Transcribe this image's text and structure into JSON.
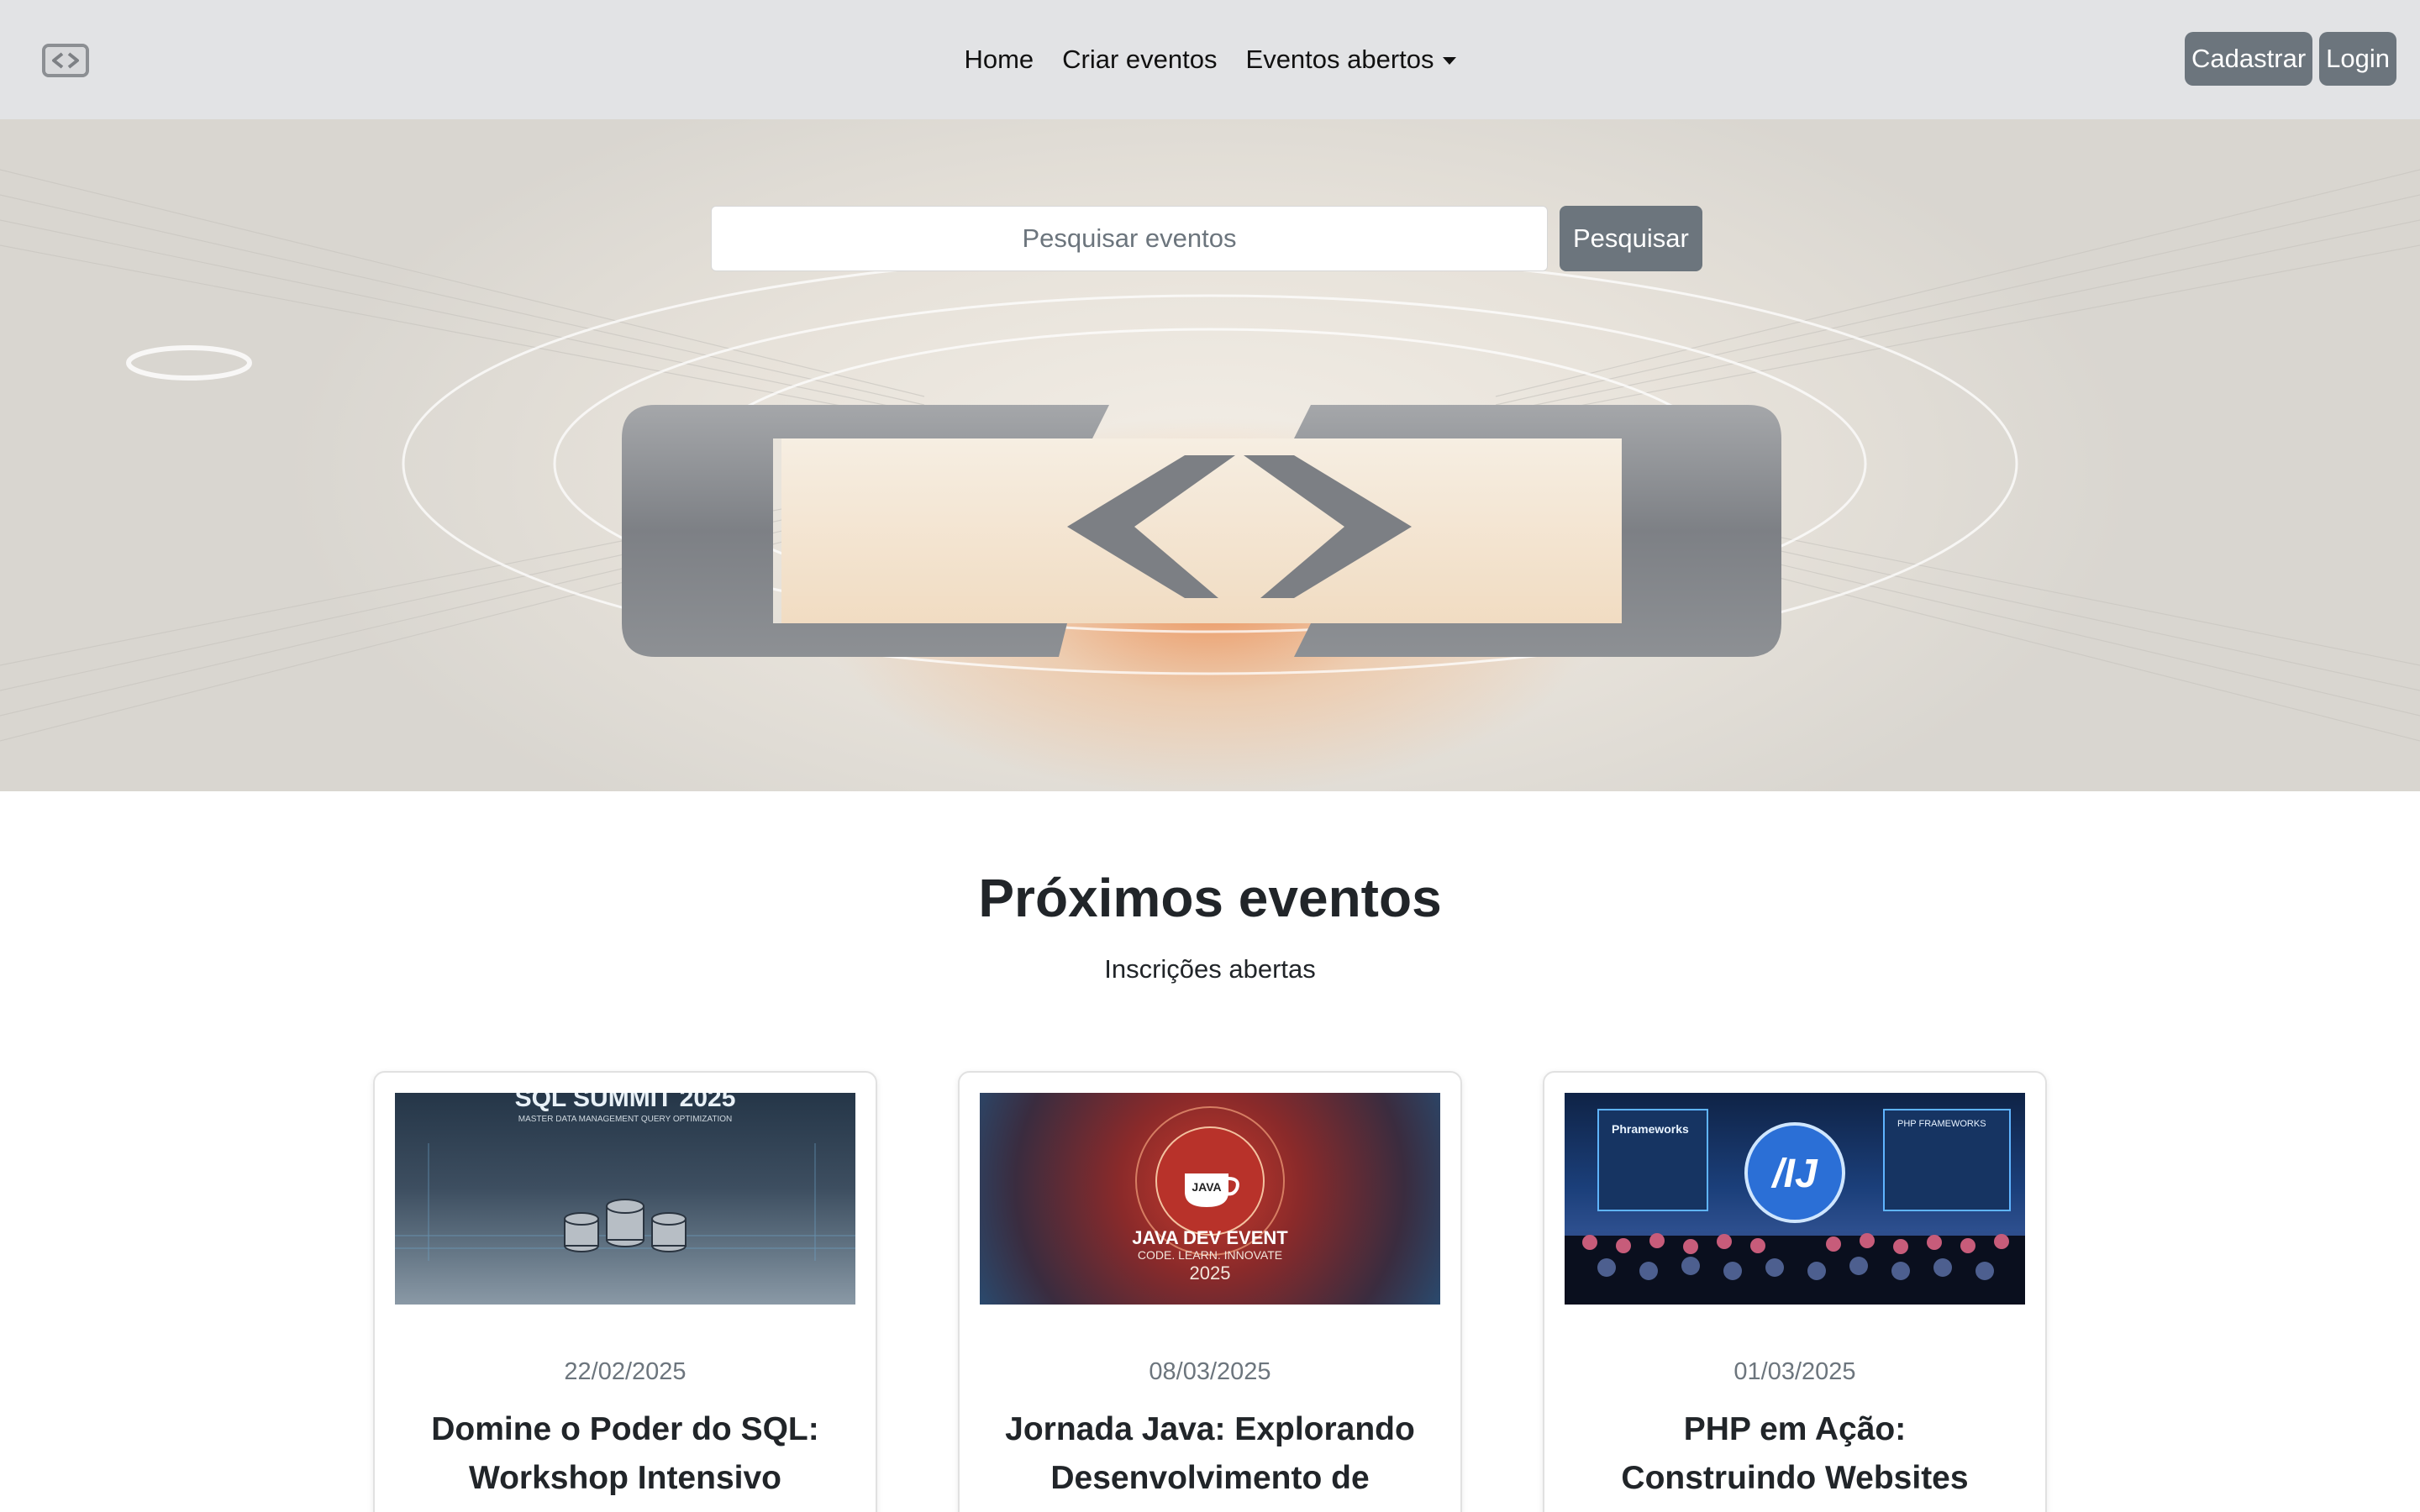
{
  "navbar": {
    "logo_icon": "code-brackets-logo-icon",
    "links": [
      {
        "label": "Home"
      },
      {
        "label": "Criar eventos"
      },
      {
        "label": "Eventos abertos"
      }
    ],
    "register_label": "Cadastrar",
    "login_label": "Login"
  },
  "hero": {
    "search_placeholder": "Pesquisar eventos",
    "search_value": "",
    "search_button_label": "Pesquisar",
    "logo_icon": "code-brackets-logo-icon"
  },
  "section": {
    "title": "Próximos eventos",
    "subtitle": "Inscrições abertas"
  },
  "events": [
    {
      "date": "22/02/2025",
      "title": "Domine o Poder do SQL: Workshop Intensivo",
      "image": {
        "banner_text": "SQL SUMMIT 2025",
        "tagline": "MASTER DATA MANAGEMENT QUERY OPTIMIZATION",
        "accent": "#5fb0e6"
      }
    },
    {
      "date": "08/03/2025",
      "title": "Jornada Java: Explorando Desenvolvimento de Software",
      "image": {
        "banner_text": "JAVA DEV EVENT",
        "tagline": "CODE. LEARN. INNOVATE",
        "year": "2025",
        "badge": "JAVA",
        "accent": "#d9402f"
      }
    },
    {
      "date": "01/03/2025",
      "title": "PHP em Ação: Construindo Websites Dinâmicos",
      "image": {
        "banner_text": "Phrameworks",
        "tagline": "PHP FRAMEWORKS",
        "accent": "#3fa9ff"
      }
    }
  ],
  "colors": {
    "navbar_bg": "#e2e3e5",
    "button_secondary": "#6c757d",
    "text_dark": "#212529",
    "text_muted": "#6c757d"
  }
}
